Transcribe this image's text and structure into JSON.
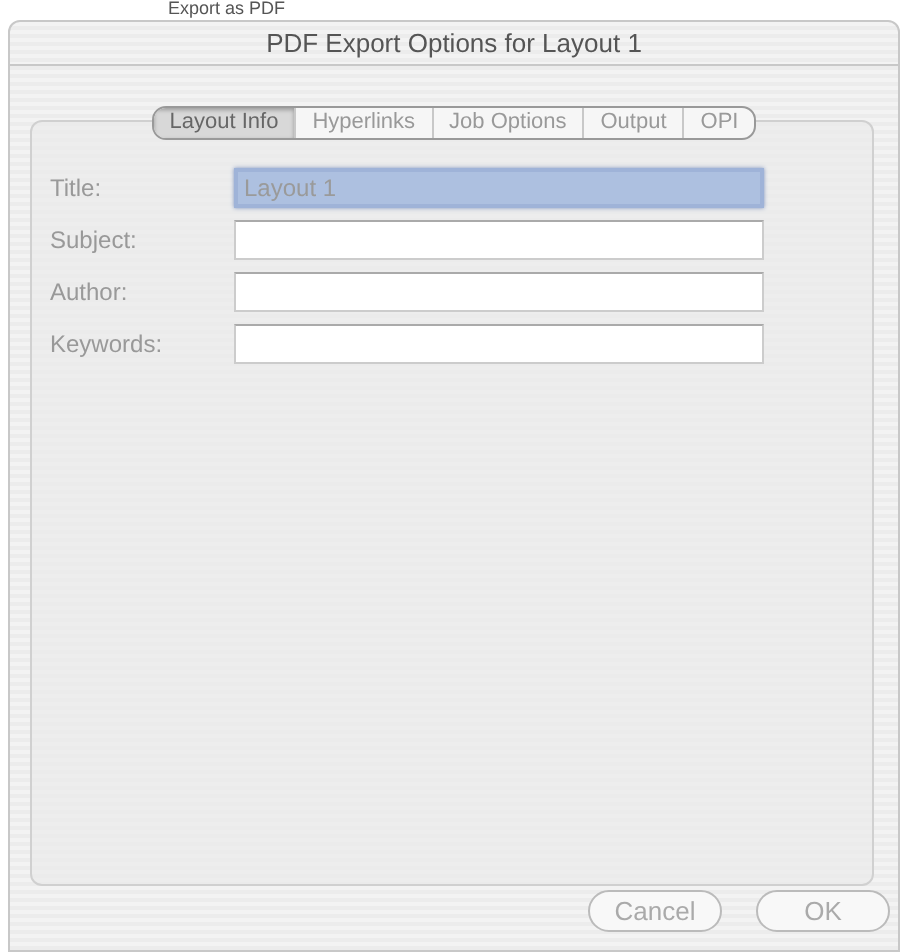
{
  "behind_window_title": "Export as PDF",
  "window": {
    "title": "PDF Export Options for Layout 1"
  },
  "tabs": [
    {
      "label": "Layout Info",
      "selected": true
    },
    {
      "label": "Hyperlinks",
      "selected": false
    },
    {
      "label": "Job Options",
      "selected": false
    },
    {
      "label": "Output",
      "selected": false
    },
    {
      "label": "OPI",
      "selected": false
    }
  ],
  "fields": [
    {
      "label": "Title:",
      "value": "Layout 1",
      "focused": true
    },
    {
      "label": "Subject:",
      "focused": false
    },
    {
      "label": "Author:",
      "focused": false
    },
    {
      "label": "Keywords:",
      "focused": false
    }
  ],
  "buttons": [
    {
      "label": "Cancel",
      "default": false
    },
    {
      "label": "OK",
      "default": false
    }
  ]
}
